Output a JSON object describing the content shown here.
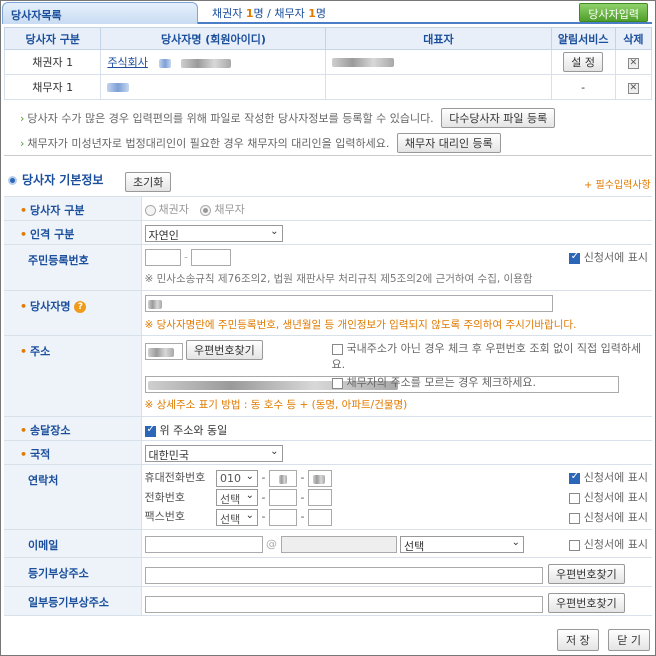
{
  "header": {
    "tab_title": "당사자목록",
    "creditor_label": "채권자",
    "creditor_count": "1",
    "count_unit": "명",
    "separator": " / ",
    "debtor_label": "채무자",
    "debtor_count": "1",
    "add_button": "당사자입력"
  },
  "party_table": {
    "columns": [
      "당사자 구분",
      "당사자명 (회원아이디)",
      "대표자",
      "알림서비스",
      "삭제"
    ],
    "rows": [
      {
        "type": "채권자 1",
        "name": "주식회사",
        "alarm": "설 정"
      },
      {
        "type": "채무자 1",
        "name": "",
        "alarm": "-"
      }
    ]
  },
  "notes": {
    "multi_text": "당사자 수가 많은 경우 입력편의를 위해 파일로 작성한 당사자정보를 등록할 수 있습니다.",
    "multi_button": "다수당사자 파일 등록",
    "minor_text": "채무자가 미성년자로 법정대리인이 필요한 경우 채무자의 대리인을 입력하세요.",
    "minor_button": "채무자 대리인 등록"
  },
  "section": {
    "title": "당사자 기본정보",
    "reset_button": "초기화",
    "required_note": "+ 필수입력사항"
  },
  "form": {
    "party_type": {
      "label": "당사자 구분",
      "opt1": "채권자",
      "opt2": "채무자",
      "selected": "채무자"
    },
    "person_type": {
      "label": "인격 구분",
      "value": "자연인"
    },
    "rrn": {
      "label": "주민등록번호",
      "hint": "※ 민사소송규칙 제76조의2, 법원 재판사무 처리규칙 제5조의2에 근거하여 수집, 이용함",
      "show_label": "신청서에 표시"
    },
    "name": {
      "label": "당사자명",
      "warn": "※ 당사자명란에 주민등록번호, 생년월일 등 개인정보가 입력되지 않도록 주의하여 주시기바랍니다."
    },
    "address": {
      "label": "주소",
      "zip_button": "우편번호찾기",
      "overseas": "국내주소가 아닌 경우 체크 후 우편번호 조회 없이 직접 입력하세요.",
      "unknown": "채무자의 주소를 모르는 경우 체크하세요.",
      "detail_hint": "※ 상세주소 표기 방법 : 동 호수 등 + (동명, 아파트/건물명)"
    },
    "delivery": {
      "label": "송달장소",
      "same": "위 주소와 동일"
    },
    "nationality": {
      "label": "국적",
      "value": "대한민국"
    },
    "contact": {
      "label": "연락처",
      "mobile": "휴대전화번호",
      "mobile_prefix": "010",
      "phone": "전화번호",
      "phone_prefix": "선택",
      "fax": "팩스번호",
      "fax_prefix": "선택",
      "dash": "-",
      "show_label": "신청서에 표시"
    },
    "email": {
      "label": "이메일",
      "at": "@",
      "domain": "선택",
      "show_label": "신청서에 표시"
    },
    "reg_address": {
      "label": "등기부상주소",
      "zip_button": "우편번호찾기"
    },
    "partial_reg_address": {
      "label": "일부등기부상주소",
      "zip_button": "우편번호찾기"
    }
  },
  "footer": {
    "save": "저 장",
    "close": "닫 기"
  }
}
